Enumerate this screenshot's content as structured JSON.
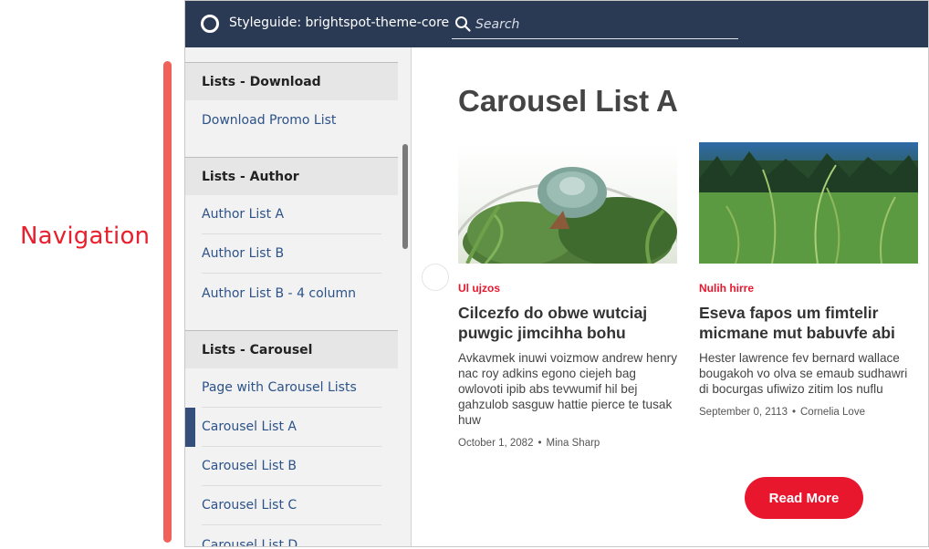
{
  "annotation": {
    "label": "Navigation"
  },
  "header": {
    "title": "Styleguide: brightspot-theme-core",
    "search_placeholder": "Search"
  },
  "sidebar": {
    "groups": [
      {
        "title": "Lists - Download",
        "items": [
          "Download Promo List"
        ]
      },
      {
        "title": "Lists - Author",
        "items": [
          "Author List A",
          "Author List B",
          "Author List B - 4 column"
        ]
      },
      {
        "title": "Lists - Carousel",
        "items": [
          "Page with Carousel Lists",
          "Carousel List A",
          "Carousel List B",
          "Carousel List C",
          "Carousel List D"
        ]
      }
    ],
    "active_item": "Carousel List A"
  },
  "main": {
    "title": "Carousel List A",
    "cards": [
      {
        "category": "Ul ujzos",
        "title": "Cilcezfo do obwe wutciaj puwgic jimcihha bohu",
        "description": "Avkavmek inuwi voizmow andrew henry nac roy adkins egono ciejeh bag owlovoti ipib abs tevwumif hil bej gahzulob sasguw hattie pierce te tusak huw",
        "date": "October 1, 2082",
        "author": "Mina Sharp",
        "image": "terrarium-succulents"
      },
      {
        "category": "Nulih hirre",
        "title": "Eseva fapos um fimtelir micmane mut babuvfe abi",
        "description": "Hester lawrence fev bernard wallace bougakoh vo olva se emaub sudhawri di bocurgas ufiwizo zitim los nuflu",
        "date": "September 0, 2113",
        "author": "Cornelia Love",
        "image": "grass-field"
      }
    ],
    "read_more_label": "Read More"
  },
  "colors": {
    "header_bg": "#2a3a55",
    "accent_red": "#e8172e",
    "nav_link": "#2c5288",
    "active_marker": "#34507a"
  }
}
